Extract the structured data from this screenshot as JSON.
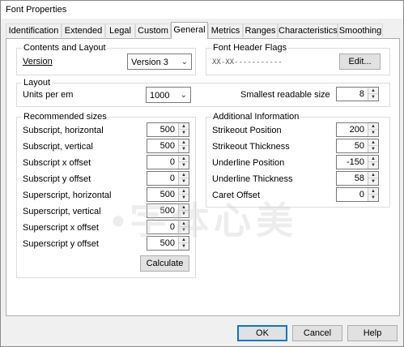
{
  "window": {
    "title": "Font Properties"
  },
  "tabs": [
    {
      "label": "Identification"
    },
    {
      "label": "Extended"
    },
    {
      "label": "Legal"
    },
    {
      "label": "Custom"
    },
    {
      "label": "General",
      "active": true
    },
    {
      "label": "Metrics"
    },
    {
      "label": "Ranges"
    },
    {
      "label": "Characteristics"
    },
    {
      "label": "Smoothing"
    }
  ],
  "contents_layout": {
    "group_label": "Contents and Layout",
    "version_label": "Version",
    "version_value": "Version 3"
  },
  "font_header_flags": {
    "group_label": "Font Header Flags",
    "flags_text": "XX-XX-----------",
    "edit_button": "Edit..."
  },
  "layout": {
    "group_label": "Layout",
    "units_label": "Units per em",
    "units_value": "1000",
    "smallest_label": "Smallest readable size",
    "smallest_value": "8"
  },
  "recommended_sizes": {
    "group_label": "Recommended sizes",
    "rows": [
      {
        "label": "Subscript, horizontal",
        "value": "500"
      },
      {
        "label": "Subscript, vertical",
        "value": "500"
      },
      {
        "label": "Subscript x offset",
        "value": "0"
      },
      {
        "label": "Subscript y offset",
        "value": "0"
      },
      {
        "label": "Superscript, horizontal",
        "value": "500"
      },
      {
        "label": "Superscript, vertical",
        "value": "500"
      },
      {
        "label": "Superscript x offset",
        "value": "0"
      },
      {
        "label": "Superscript y offset",
        "value": "500"
      }
    ],
    "calculate_button": "Calculate"
  },
  "additional_info": {
    "group_label": "Additional Information",
    "rows": [
      {
        "label": "Strikeout Position",
        "value": "200"
      },
      {
        "label": "Strikeout Thickness",
        "value": "50"
      },
      {
        "label": "Underline Position",
        "value": "-150"
      },
      {
        "label": "Underline Thickness",
        "value": "58"
      },
      {
        "label": "Caret Offset",
        "value": "0"
      }
    ]
  },
  "footer": {
    "ok": "OK",
    "cancel": "Cancel",
    "help": "Help"
  },
  "watermark": "•字体心美"
}
